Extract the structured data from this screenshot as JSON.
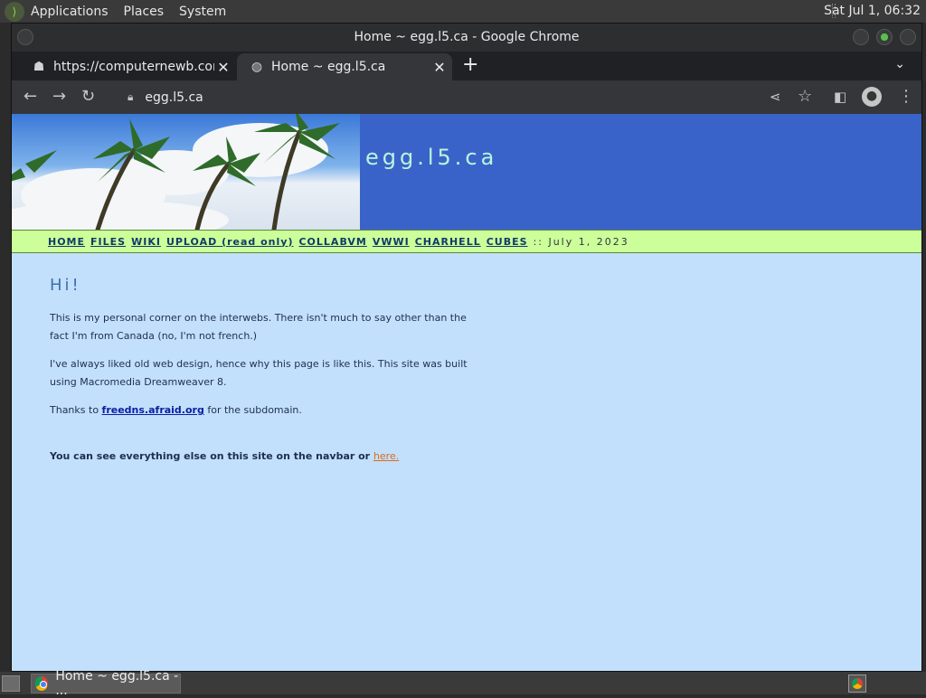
{
  "desktop": {
    "menus": [
      "Applications",
      "Places",
      "System"
    ],
    "clock": "Sat Jul  1, 06:32"
  },
  "window": {
    "title": "Home ~ egg.l5.ca - Google Chrome"
  },
  "tabs": [
    {
      "label": "https://computernewb.com/Ch",
      "icon": "page-favicon-icon"
    },
    {
      "label": "Home ~ egg.l5.ca",
      "icon": "globe-icon"
    }
  ],
  "toolbar": {
    "url": "egg.l5.ca"
  },
  "site": {
    "title": "egg.l5.ca",
    "nav": [
      "HOME",
      "FILES",
      "WIKI",
      "UPLOAD (read only)",
      "COLLABVM",
      "VWWI",
      "CHARHELL",
      "CUBES"
    ],
    "nav_date": ":: July 1, 2023",
    "heading": "Hi!",
    "p1": "This is my personal corner on the interwebs. There isn't much to say other than the fact I'm from Canada (no, I'm not french.)",
    "p2": "I've always liked old web design, hence why this page is like this. This site was built using Macromedia Dreamweaver 8.",
    "p3_before": "Thanks to ",
    "p3_link": "freedns.afraid.org",
    "p3_after": " for the subdomain.",
    "p4_text": "You can see everything else on this site on the navbar or ",
    "p4_link": "here."
  },
  "taskbar": {
    "task_label": "Home ~ egg.l5.ca - ..."
  },
  "colors": {
    "page_bg": "#c2e0fb",
    "banner_blue": "#3a63c9",
    "navbar_green": "#ccff99",
    "link_blue": "#0b1fa3",
    "here_orange": "#e06a1a"
  }
}
